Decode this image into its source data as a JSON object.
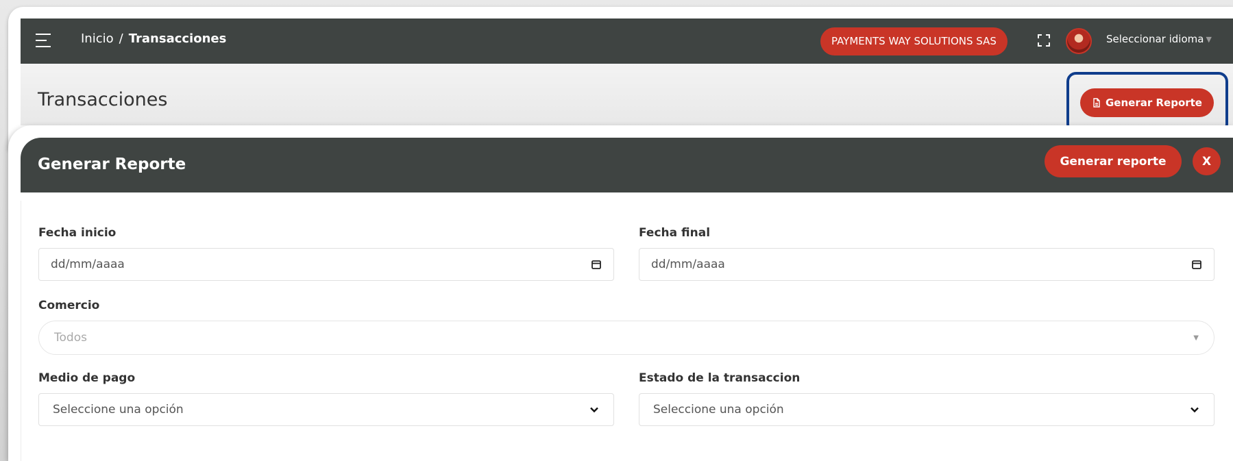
{
  "topbar": {
    "breadcrumb_home": "Inicio",
    "breadcrumb_separator": "/",
    "breadcrumb_current": "Transacciones",
    "company_name": "PAYMENTS WAY SOLUTIONS SAS",
    "language_select": "Seleccionar idioma",
    "language_caret": "▼"
  },
  "page": {
    "title": "Transacciones",
    "generate_report_button": "Generar Reporte"
  },
  "modal": {
    "title": "Generar Reporte",
    "generate_button": "Generar reporte",
    "close_button": "X",
    "fields": {
      "start_date": {
        "label": "Fecha inicio",
        "placeholder": "dd/mm/aaaa"
      },
      "end_date": {
        "label": "Fecha final",
        "placeholder": "dd/mm/aaaa"
      },
      "merchant": {
        "label": "Comercio",
        "value": "Todos"
      },
      "payment_method": {
        "label": "Medio de pago",
        "value": "Seleccione una opción"
      },
      "transaction_status": {
        "label": "Estado de la transaccion",
        "value": "Seleccione una opción"
      }
    }
  },
  "colors": {
    "topbar": "#3f4442",
    "accent": "#c93527",
    "highlight": "#0f3d8c"
  },
  "icons": {
    "menu": "hamburger-icon",
    "fullscreen": "expand-icon",
    "report": "document-icon",
    "calendar": "calendar-icon",
    "dropdown": "chevron-down-icon"
  }
}
